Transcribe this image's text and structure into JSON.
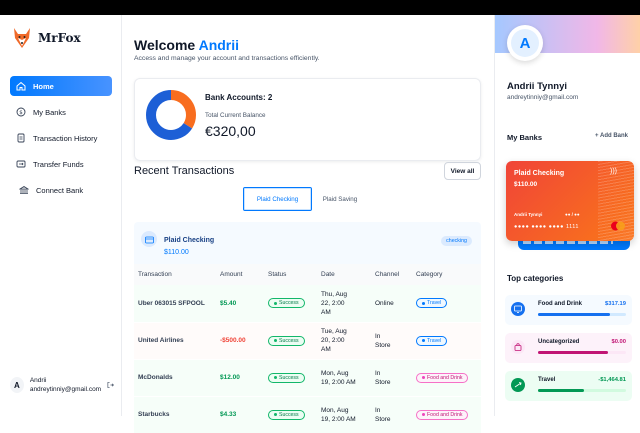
{
  "app": {
    "name": "MrFox"
  },
  "sidebar": {
    "items": [
      {
        "label": "Home",
        "icon": "home-icon",
        "active": true
      },
      {
        "label": "My Banks",
        "icon": "dollar-circle-icon"
      },
      {
        "label": "Transaction History",
        "icon": "receipt-icon"
      },
      {
        "label": "Transfer Funds",
        "icon": "transfer-icon"
      },
      {
        "label": "Connect Bank",
        "icon": "bank-icon"
      }
    ],
    "user": {
      "initial": "A",
      "name": "Andrii",
      "email": "andreytinniy@gmail.com"
    }
  },
  "header": {
    "greeting": "Welcome",
    "user_name": "Andrii",
    "subtitle": "Access and manage your account and transactions efficiently."
  },
  "summary": {
    "bank_accounts_label": "Bank Accounts: 2",
    "total_label": "Total Current Balance",
    "total_value": "€320,00",
    "donut_colors": [
      "#F86D1F",
      "#1D5FD6"
    ],
    "donut_split": [
      0.34,
      0.66
    ]
  },
  "recent": {
    "title": "Recent Transactions",
    "view_all": "View all",
    "tabs": [
      {
        "label": "Plaid Checking",
        "active": true
      },
      {
        "label": "Plaid Saving"
      }
    ],
    "account": {
      "name": "Plaid Checking",
      "balance": "$110.00",
      "type": "checking"
    },
    "columns": [
      "Transaction",
      "Amount",
      "Status",
      "Date",
      "Channel",
      "Category"
    ],
    "rows": [
      {
        "name": "Uber 063015 SFPOOL",
        "amount": "$5.40",
        "status": "Success",
        "date": [
          "Thu, Aug",
          "22, 2:00",
          "AM"
        ],
        "channel": [
          "Online"
        ],
        "category": "Travel"
      },
      {
        "name": "United Airlines",
        "amount": "-$500.00",
        "status": "Success",
        "date": [
          "Tue, Aug",
          "20, 2:00",
          "AM"
        ],
        "channel": [
          "In",
          "Store"
        ],
        "category": "Travel"
      },
      {
        "name": "McDonalds",
        "amount": "$12.00",
        "status": "Success",
        "date": [
          "Mon, Aug",
          "19, 2:00 AM"
        ],
        "channel": [
          "In",
          "Store"
        ],
        "category": "Food and Drink"
      },
      {
        "name": "Starbucks",
        "amount": "$4.33",
        "status": "Success",
        "date": [
          "Mon, Aug",
          "19, 2:00 AM"
        ],
        "channel": [
          "In",
          "Store"
        ],
        "category": "Food and Drink"
      }
    ]
  },
  "profile": {
    "initial": "A",
    "name": "Andrii Tynnyi",
    "email": "andreytinniy@gmail.com",
    "my_banks": "My Banks",
    "add_bank": "Add Bank",
    "card": {
      "name": "Plaid Checking",
      "balance": "$110.00",
      "holder": "Andrii Tynnyi",
      "expiry": "●● / ●●",
      "number": "●●●● ●●●● ●●●● 1111"
    },
    "top_categories": "Top categories",
    "categories": [
      {
        "name": "Food and Drink",
        "amount": "$317.19",
        "fill": 0.82,
        "bg": "#F5FAFF",
        "color": "#1570EF",
        "track": "#D1E9FF",
        "icon": "monitor-icon"
      },
      {
        "name": "Uncategorized",
        "amount": "$0.00",
        "fill": 0.8,
        "bg": "#FDF2FA",
        "color": "#C11574",
        "track": "#FCE7F6",
        "icon": "bag-icon"
      },
      {
        "name": "Travel",
        "amount": "-$1,464.81",
        "fill": 0.52,
        "bg": "#ECFDF3",
        "color": "#039855",
        "track": "#D1FADF",
        "icon": "plane-icon"
      }
    ]
  }
}
